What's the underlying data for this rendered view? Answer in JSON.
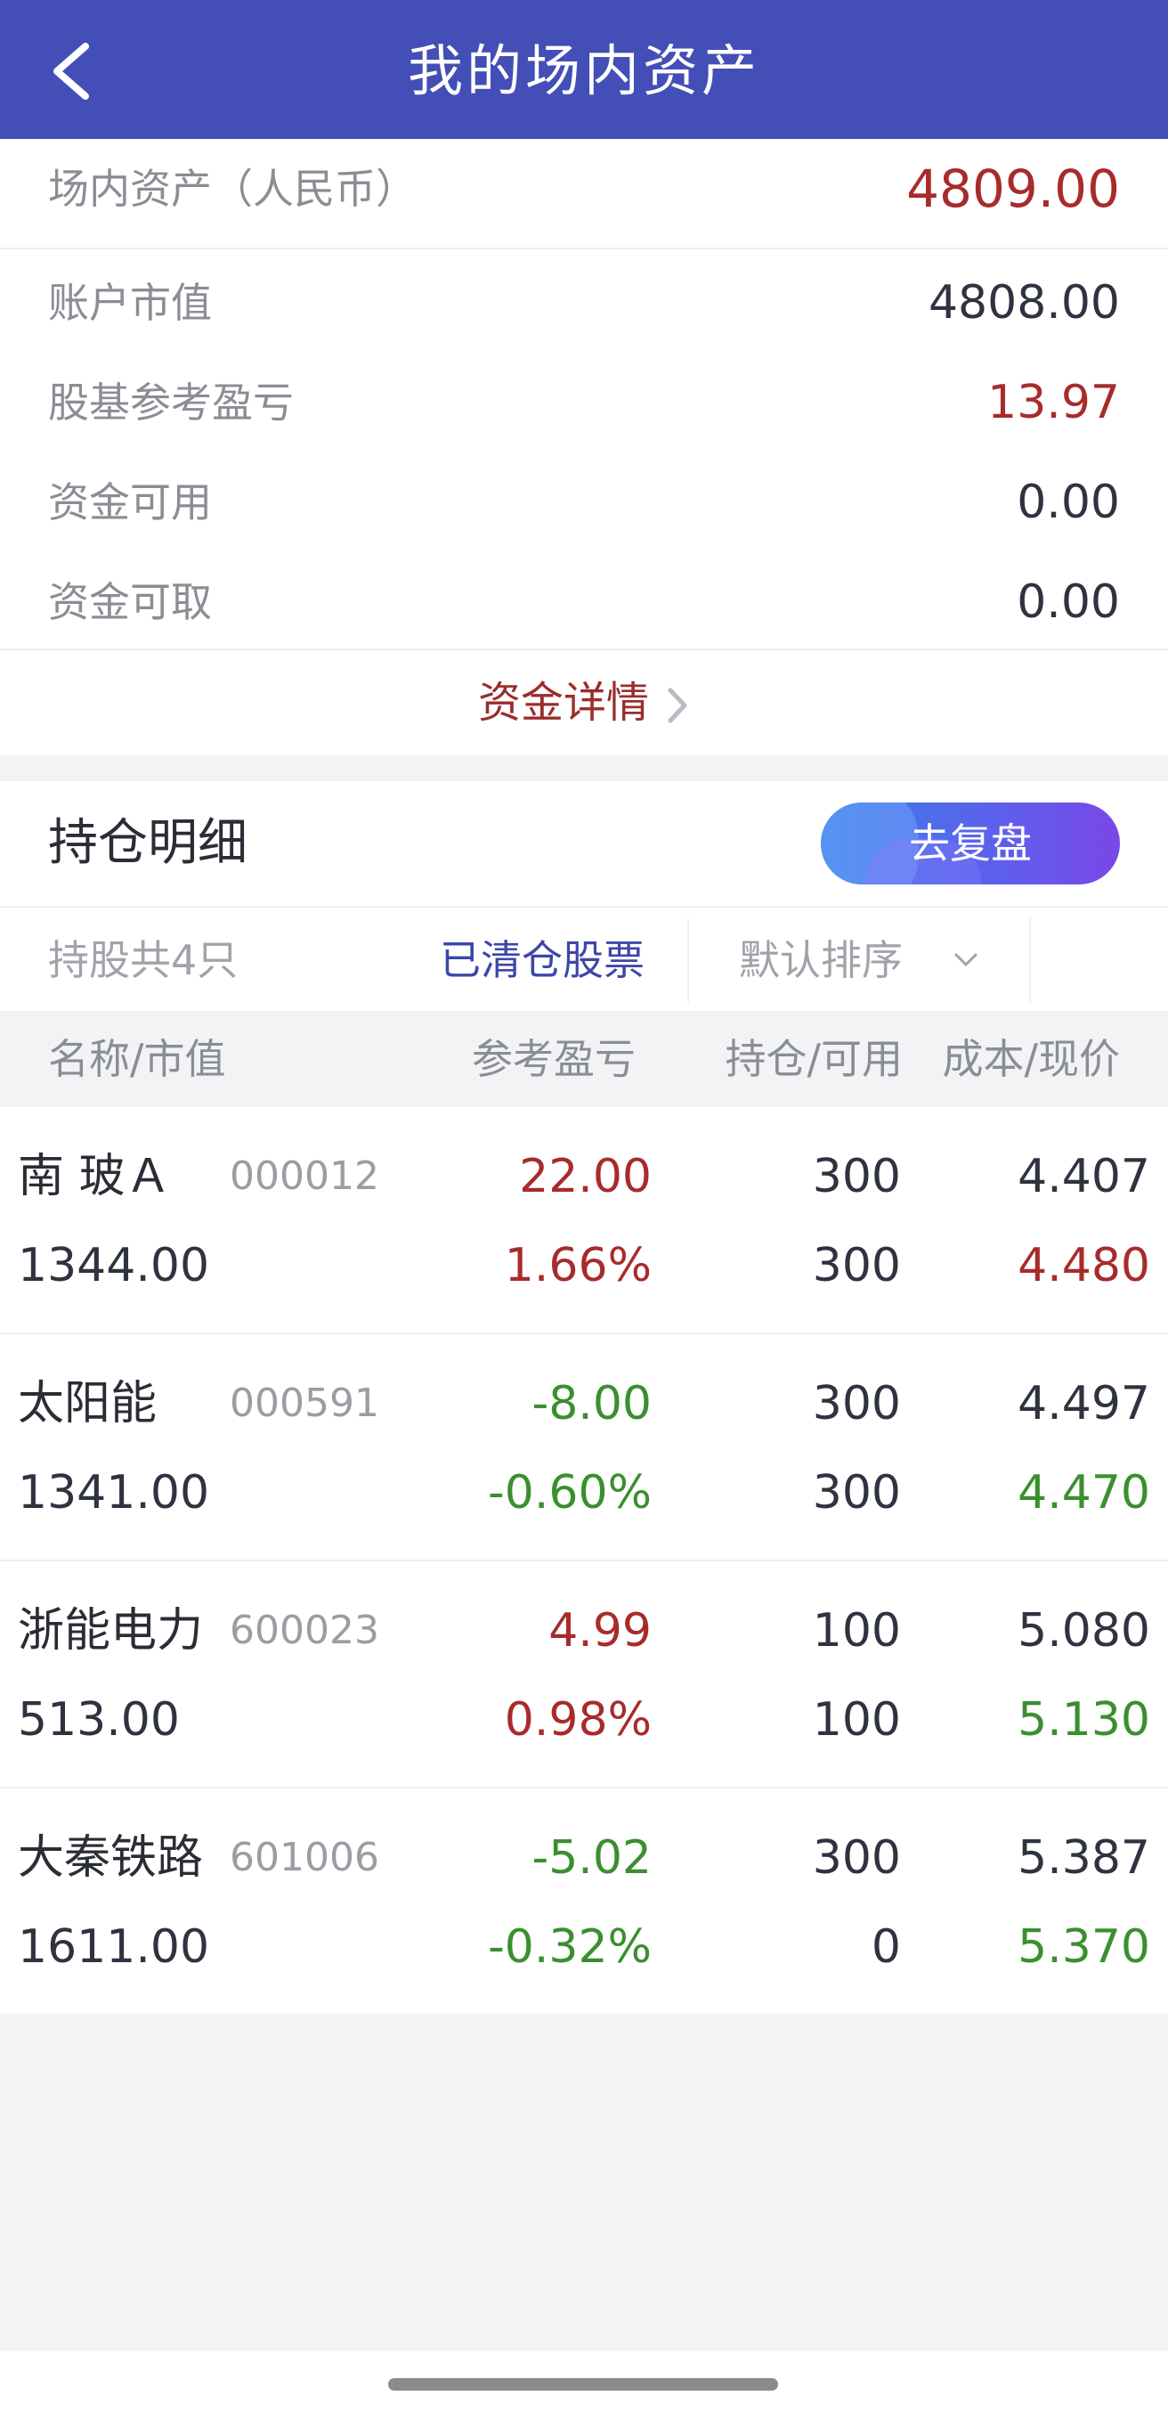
{
  "header": {
    "title": "我的场内资产"
  },
  "assets": {
    "total": {
      "label": "场内资产（人民币）",
      "value": "4809.00"
    },
    "rows": [
      {
        "label": "账户市值",
        "value": "4808.00"
      },
      {
        "label": "股基参考盈亏",
        "value": "13.97"
      },
      {
        "label": "资金可用",
        "value": "0.00"
      },
      {
        "label": "资金可取",
        "value": "0.00"
      }
    ],
    "detail_link": "资金详情"
  },
  "holdings": {
    "title": "持仓明细",
    "review_button": "去复盘",
    "filter": {
      "count": "持股共4只",
      "cleared": "已清仓股票",
      "sort": "默认排序"
    },
    "columns": [
      "名称/市值",
      "参考盈亏",
      "持仓/可用",
      "成本/现价"
    ],
    "items": [
      {
        "name": "南 玻Ａ",
        "code": "000012",
        "market_value": "1344.00",
        "pl": "22.00",
        "pl_pct": "1.66%",
        "hold": "300",
        "avail": "300",
        "cost": "4.407",
        "price": "4.480",
        "trend": "up"
      },
      {
        "name": "太阳能",
        "code": "000591",
        "market_value": "1341.00",
        "pl": "-8.00",
        "pl_pct": "-0.60%",
        "hold": "300",
        "avail": "300",
        "cost": "4.497",
        "price": "4.470",
        "trend": "down"
      },
      {
        "name": "浙能电力",
        "code": "600023",
        "market_value": "513.00",
        "pl": "4.99",
        "pl_pct": "0.98%",
        "hold": "100",
        "avail": "100",
        "cost": "5.080",
        "price": "5.130",
        "trend": "mixed"
      },
      {
        "name": "大秦铁路",
        "code": "601006",
        "market_value": "1611.00",
        "pl": "-5.02",
        "pl_pct": "-0.32%",
        "hold": "300",
        "avail": "0",
        "cost": "5.387",
        "price": "5.370",
        "trend": "down"
      }
    ]
  },
  "colors": {
    "header": "#434eb7",
    "red": "#a82b2b",
    "green": "#3a8f2f",
    "link": "#3c47a8"
  },
  "icons": {
    "back": "chevron-left-icon",
    "detail": "chevron-right-icon",
    "sort": "chevron-down-icon"
  }
}
